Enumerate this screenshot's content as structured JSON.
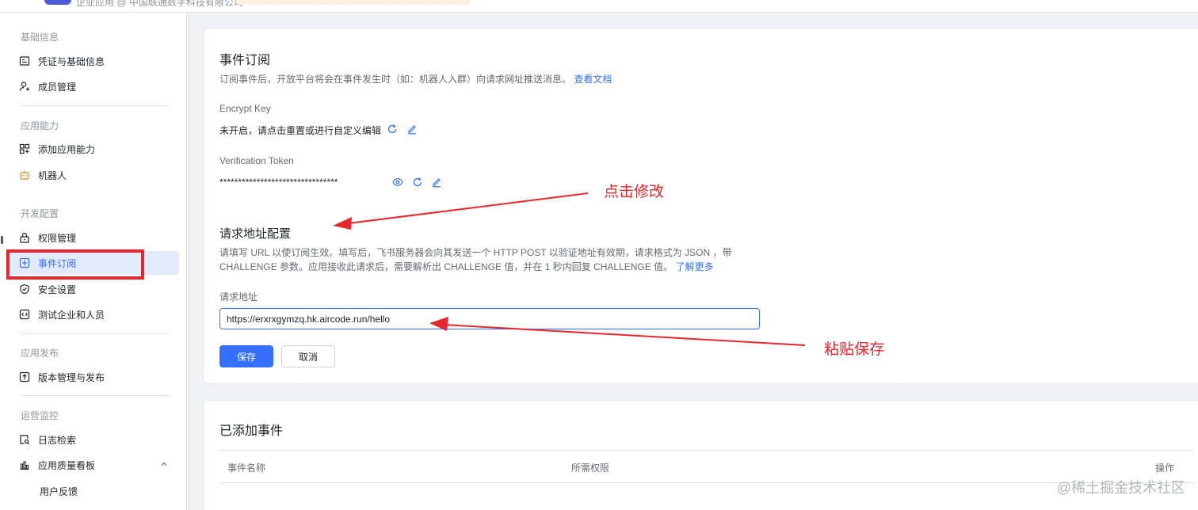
{
  "header": {
    "app_subtitle": "企业应用 @ 中国联通数字科技有限公司"
  },
  "sidebar": {
    "groups": [
      {
        "title": "基础信息",
        "items": [
          {
            "label": "凭证与基础信息",
            "icon": "credential-icon"
          },
          {
            "label": "成员管理",
            "icon": "member-icon"
          }
        ]
      },
      {
        "title": "应用能力",
        "items": [
          {
            "label": "添加应用能力",
            "icon": "apps-grid-icon"
          },
          {
            "label": "机器人",
            "icon": "bot-icon"
          }
        ]
      },
      {
        "title": "开发配置",
        "items": [
          {
            "label": "权限管理",
            "icon": "lock-icon"
          },
          {
            "label": "事件订阅",
            "icon": "event-icon",
            "active": true
          },
          {
            "label": "安全设置",
            "icon": "shield-icon"
          },
          {
            "label": "测试企业和人员",
            "icon": "code-icon"
          }
        ]
      },
      {
        "title": "应用发布",
        "items": [
          {
            "label": "版本管理与发布",
            "icon": "upload-icon"
          }
        ]
      },
      {
        "title": "运营监控",
        "items": [
          {
            "label": "日志检索",
            "icon": "log-search-icon"
          },
          {
            "label": "应用质量看板",
            "icon": "bar-chart-icon",
            "expanded": true
          },
          {
            "label": "用户反馈",
            "icon": ""
          }
        ]
      }
    ]
  },
  "event_subscription": {
    "title": "事件订阅",
    "description": "订阅事件后，开放平台将会在事件发生时（如：机器人入群）向请求网址推送消息。",
    "doc_link": "查看文档",
    "encrypt_key": {
      "label": "Encrypt Key",
      "value": "未开启，请点击重置或进行自定义编辑"
    },
    "verification_token": {
      "label": "Verification Token",
      "value": "********************************"
    },
    "request_config": {
      "title": "请求地址配置",
      "desc_line1": "请填写 URL 以使订阅生效。填写后，飞书服务器会向其发送一个 HTTP POST 以验证地址有效期，请求格式为 JSON ，带",
      "desc_line2": "CHALLENGE 参数。应用接收此请求后，需要解析出 CHALLENGE 值，并在 1 秒内回复 CHALLENGE 值。",
      "learn_more": "了解更多",
      "url_label": "请求地址",
      "url_value": "https://erxrxgymzq.hk.aircode.run/hello",
      "save_label": "保存",
      "cancel_label": "取消"
    }
  },
  "added_events": {
    "title": "已添加事件",
    "columns": [
      "事件名称",
      "所需权限",
      "操作"
    ]
  },
  "annotations": {
    "click_edit": "点击修改",
    "paste_save": "粘贴保存",
    "color": "#e8262b"
  },
  "watermark": "@稀土掘金技术社区"
}
